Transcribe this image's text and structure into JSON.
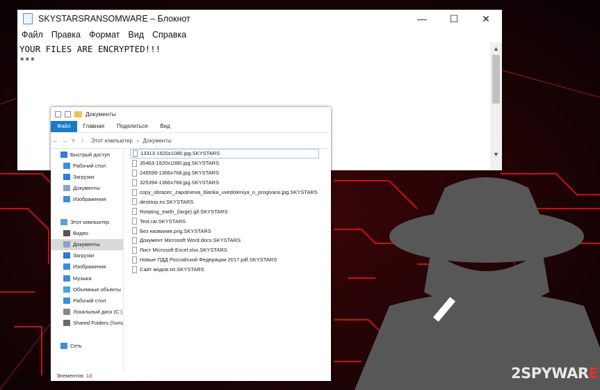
{
  "colors": {
    "accent": "#1979ca",
    "watermark_red": "#e0312c",
    "background": "#1a0406"
  },
  "notepad": {
    "title": "SKYSTARSRANSOMWARE – Блокнот",
    "menu": [
      "Файл",
      "Правка",
      "Формат",
      "Вид",
      "Справка"
    ],
    "lines": [
      "YOUR FILES ARE ENCRYPTED!!!",
      "***"
    ],
    "window_buttons": {
      "minimize": "—",
      "maximize": "☐",
      "close": "✕"
    }
  },
  "explorer": {
    "title": "Документы",
    "ribbon": [
      "Файл",
      "Главная",
      "Поделиться",
      "Вид"
    ],
    "breadcrumb": [
      "Этот компьютер",
      "Документы"
    ],
    "sidebar": [
      {
        "label": "Быстрый доступ",
        "icon": "star-icon"
      },
      {
        "label": "Рабочий стол",
        "icon": "desktop-icon"
      },
      {
        "label": "Загрузки",
        "icon": "download-icon"
      },
      {
        "label": "Документы",
        "icon": "documents-icon"
      },
      {
        "label": "Изображения",
        "icon": "pictures-icon"
      },
      {
        "label": "",
        "icon": ""
      },
      {
        "label": "Этот компьютер",
        "icon": "computer-icon"
      },
      {
        "label": "Видео",
        "icon": "video-icon"
      },
      {
        "label": "Документы",
        "icon": "documents-icon"
      },
      {
        "label": "Загрузки",
        "icon": "download-icon"
      },
      {
        "label": "Изображения",
        "icon": "pictures-icon"
      },
      {
        "label": "Музыка",
        "icon": "music-icon"
      },
      {
        "label": "Объемные объекты",
        "icon": "objects-icon"
      },
      {
        "label": "Рабочий стол",
        "icon": "desktop-icon"
      },
      {
        "label": "Локальный диск (C:)",
        "icon": "drive-icon"
      },
      {
        "label": "Shared Folders (\\\\vmware-host)",
        "icon": "network-drive-icon"
      },
      {
        "label": "",
        "icon": ""
      },
      {
        "label": "Сеть",
        "icon": "network-icon"
      }
    ],
    "files": [
      "13313-1920x1080.jpg.SKYSTARS",
      "35463-1920x1080.jpg.SKYSTARS",
      "246598-1366x768.jpg.SKYSTARS",
      "325394-1366x768.jpg.SKYSTARS",
      "copy_obrazec_zapolnenia_blanka_uvedoleniya_o_progivanii.jpg.SKYSTARS",
      "desktop.ini.SKYSTARS",
      "Rotating_earth_(large).gif.SKYSTARS",
      "Test.rar.SKYSTARS",
      "Без названия.png.SKYSTARS",
      "Документ Microsoft Word.docx.SKYSTARS",
      "Лист Microsoft Excel.xlsx.SKYSTARS",
      "Новые ПДД Российской Федерации 2017.pdf.SKYSTARS",
      "Сайт модов.txt.SKYSTARS"
    ],
    "status": "Элементов: 13"
  },
  "watermark": {
    "part1": "2",
    "part2": "SPYWAR",
    "part3": "E"
  }
}
